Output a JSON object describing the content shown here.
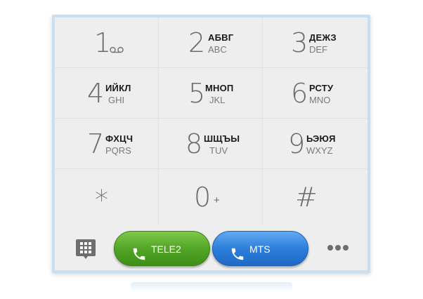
{
  "keypad": {
    "keys": [
      {
        "digit": "1",
        "cyr": "",
        "lat": "",
        "extra": "voicemail-icon"
      },
      {
        "digit": "2",
        "cyr": "АБВГ",
        "lat": "ABC"
      },
      {
        "digit": "3",
        "cyr": "ДЕЖЗ",
        "lat": "DEF"
      },
      {
        "digit": "4",
        "cyr": "ИЙКЛ",
        "lat": "GHI"
      },
      {
        "digit": "5",
        "cyr": "МНОП",
        "lat": "JKL"
      },
      {
        "digit": "6",
        "cyr": "РСТУ",
        "lat": "MNO"
      },
      {
        "digit": "7",
        "cyr": "ФХЦЧ",
        "lat": "PQRS"
      },
      {
        "digit": "8",
        "cyr": "ШЩЪЫ",
        "lat": "TUV"
      },
      {
        "digit": "9",
        "cyr": "ЬЭЮЯ",
        "lat": "WXYZ"
      },
      {
        "digit": "*",
        "cyr": "",
        "lat": ""
      },
      {
        "digit": "0",
        "cyr": "",
        "lat": "",
        "extra": "+"
      },
      {
        "digit": "#",
        "cyr": "",
        "lat": ""
      }
    ]
  },
  "bottom_bar": {
    "message_icon": "dialpad-message-icon",
    "call_buttons": [
      {
        "label": "TELE2",
        "color": "#52a526",
        "icon": "phone-icon"
      },
      {
        "label": "MTS",
        "color": "#2d7fdc",
        "icon": "phone-icon"
      }
    ],
    "more_icon": "more-options-icon"
  },
  "colors": {
    "frame": "#c9dff0",
    "screen_bg": "#eeeeee",
    "digit": "#6b6b6b"
  }
}
